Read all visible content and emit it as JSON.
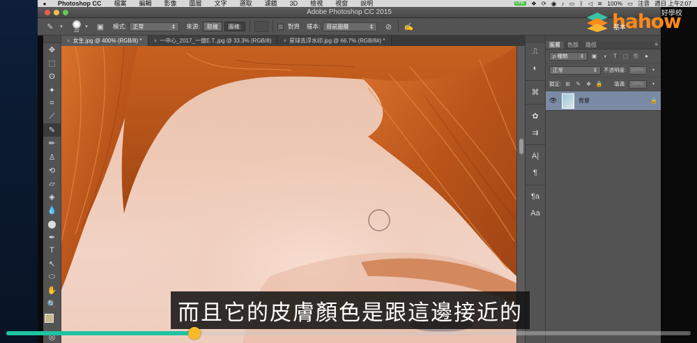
{
  "menubar": {
    "app": "Photoshop CC",
    "items": [
      "檔案",
      "編輯",
      "影像",
      "圖層",
      "文字",
      "選取",
      "濾鏡",
      "3D",
      "檢視",
      "視窗",
      "說明"
    ],
    "status": [
      "LINE",
      "100%",
      "注音",
      "週日 上午2:07"
    ]
  },
  "window": {
    "title": "Adobe Photoshop CC 2015",
    "traffic_lights": [
      "#ee5c54",
      "#f5bd4f",
      "#5fca55"
    ]
  },
  "options": {
    "brush_size": "22",
    "mode_label": "模式:",
    "mode_value": "正常",
    "source_label": "來源:",
    "sampled": "取樣",
    "pattern": "圖樣:",
    "aligned": "對齊",
    "sample_label": "樣本:",
    "sample_value": "目前圖層"
  },
  "tabs": [
    {
      "label": "女生.jpg @ 400% (RGB/8) *",
      "active": true
    },
    {
      "label": "一中心_2017_一億E.T..jpg @ 33.3% (RGB/8)",
      "active": false
    },
    {
      "label": "星球去浮水印.jpg @ 66.7% (RGB/8#) *",
      "active": false
    }
  ],
  "tools": [
    "move-icon",
    "marquee-icon",
    "lasso-icon",
    "magic-wand-icon",
    "crop-icon",
    "eyedropper-icon",
    "healing-brush-icon",
    "brush-icon",
    "stamp-icon",
    "history-brush-icon",
    "eraser-icon",
    "paint-bucket-icon",
    "blur-icon",
    "dodge-icon",
    "pen-icon",
    "type-icon",
    "path-select-icon",
    "ellipse-icon",
    "hand-icon",
    "zoom-icon"
  ],
  "tool_glyphs": [
    "✥",
    "⬚",
    "ʘ",
    "✦",
    "⌗",
    "⟋",
    "✎",
    "✏",
    "♙",
    "⟲",
    "▱",
    "◈",
    "💧",
    "⬤",
    "✒",
    "T",
    "↖",
    "⬭",
    "✋",
    "🔍"
  ],
  "layers_panel": {
    "tabs": [
      "圖層",
      "色版",
      "路徑"
    ],
    "filter": "ρ 種類",
    "blend": "正常",
    "opacity_label": "不透明度:",
    "opacity": "100%",
    "lock_label": "鎖定:",
    "fill_label": "填滿:",
    "fill": "100%",
    "layer_name": "背景"
  },
  "watermark": {
    "word": "hahow",
    "sub": "好學校",
    "overlay": "基本"
  },
  "subtitle": "而且它的皮膚顏色是跟這邊接近的",
  "video": {
    "progress": 0.275,
    "fill_color": "#1ec3a2",
    "knob_color": "#f7b928"
  }
}
